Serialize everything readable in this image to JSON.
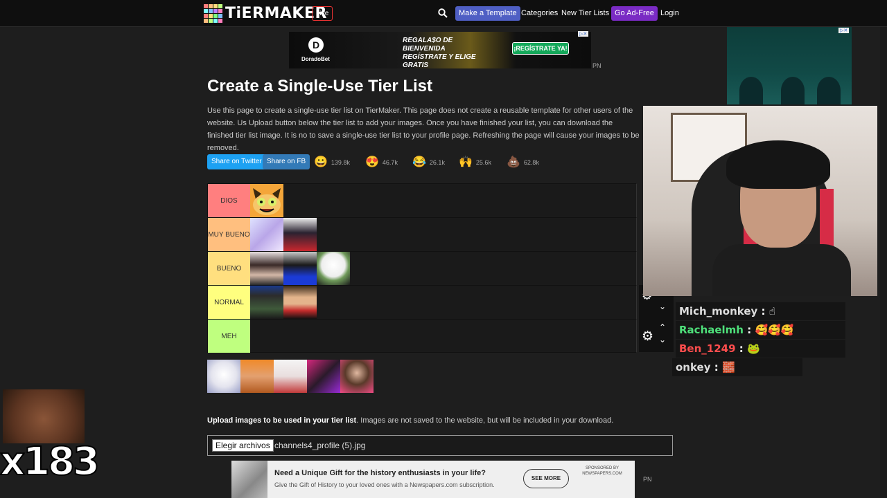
{
  "nav": {
    "logo": "TiERMAKER",
    "live": "Live",
    "make_template": "Make a Template",
    "categories": "Categories",
    "new_lists": "New Tier Lists",
    "ad_free": "Go Ad-Free",
    "login": "Login",
    "colors": {
      "template_btn": "#4f5fc4",
      "ad_free_btn": "#7a2bc4"
    }
  },
  "top_ad": {
    "brand": "DoradoBet",
    "promo": "REGALA$O DE BIENVENIDA REGÍSTRATE Y ELIGE GRATIS",
    "cta": "¡REGÍSTRATE YA!",
    "marker": "PN"
  },
  "page": {
    "title": "Create a Single-Use Tier List",
    "intro": "Use this page to create a single-use tier list on TierMaker. This page does not create a reusable template for other users of the website. Us Upload button below the tier list to add your images. Once you have finished your list, you can download the finished tier list image. It is no to save a single-use tier list to your profile page. Refreshing the page will cause your images to be removed."
  },
  "share": {
    "twitter": "Share on Twitter",
    "facebook": "Share on FB",
    "twitter_color": "#1da1f2"
  },
  "reactions": [
    {
      "icon": "grin-emoji-icon",
      "glyph": "😀",
      "count": "139.8k"
    },
    {
      "icon": "heart-eyes-emoji-icon",
      "glyph": "😍",
      "count": "46.7k"
    },
    {
      "icon": "laughing-emoji-icon",
      "glyph": "😂",
      "count": "26.1k"
    },
    {
      "icon": "clapping-hands-icon",
      "glyph": "🙌",
      "count": "25.6k"
    },
    {
      "icon": "poop-emoji-icon",
      "glyph": "💩",
      "count": "62.8k"
    }
  ],
  "tiers": [
    {
      "label": "DIOS",
      "color": "#ff7f7f",
      "items": 1
    },
    {
      "label": "MUY BUENO",
      "color": "#ffbf7f",
      "items": 2
    },
    {
      "label": "BUENO",
      "color": "#ffdf7f",
      "items": 3
    },
    {
      "label": "NORMAL",
      "color": "#ffff7f",
      "items": 2
    },
    {
      "label": "MEH",
      "color": "#bfff7f",
      "items": 0
    }
  ],
  "upload": {
    "bold": "Upload images to be used in your tier list",
    "rest": ". Images are not saved to the website, but will be included in your download.",
    "button": "Elegir archivos",
    "filename": "channels4_profile (5).jpg"
  },
  "bottom_ad": {
    "title": "Need a Unique Gift for the history enthusiasts in your life?",
    "subtitle": "Give the Gift of History to your loved ones with a Newspapers.com subscription.",
    "cta": "SEE MORE",
    "sponsor": "SPONSORED BY NEWSPAPERS.COM",
    "marker": "PN"
  },
  "chat": [
    {
      "user": "Mich_monkey",
      "color": "#dddddd",
      "msg": " : ☝"
    },
    {
      "user": "Rachaelmh",
      "color": "#4ee07a",
      "msg": " : 🥰🥰🥰"
    },
    {
      "user": "Ben_1249",
      "color": "#ff4d4d",
      "msg": " : 🐸"
    },
    {
      "user": "onkey",
      "color": "#dddddd",
      "msg": " : 🧱"
    }
  ],
  "streak": {
    "count": "x183"
  }
}
